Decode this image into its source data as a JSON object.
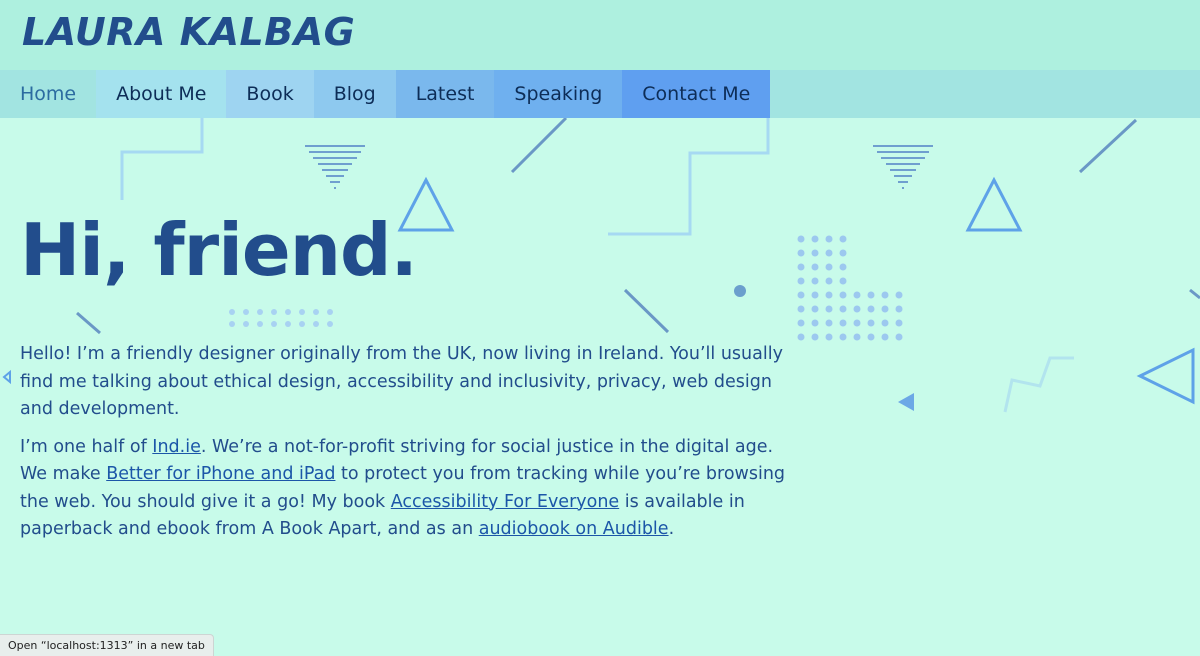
{
  "site": {
    "logo": "LAURA KALBAG"
  },
  "nav": {
    "items": [
      {
        "label": "Home"
      },
      {
        "label": "About Me"
      },
      {
        "label": "Book"
      },
      {
        "label": "Blog"
      },
      {
        "label": "Latest"
      },
      {
        "label": "Speaking"
      },
      {
        "label": "Contact Me"
      }
    ]
  },
  "main": {
    "heading": "Hi, friend.",
    "intro": "Hello! I’m a friendly designer originally from the UK, now living in Ireland. You’ll usually find me talking about ethical design, accessibility and inclusivity, privacy, web design and development.",
    "p2": {
      "t1": "I’m one half of ",
      "link_indie": "Ind.ie",
      "t2": ". We’re a not-for-profit striving for social justice in the digital age. We make ",
      "link_better": "Better for iPhone and iPad",
      "t3": " to protect you from tracking while you’re browsing the web. You should give it a go! My book ",
      "link_book": "Accessibility For Everyone",
      "t4": " is available in paperback and ebook from A Book Apart, and as an ",
      "link_audio": "audiobook on Audible",
      "t5": "."
    }
  },
  "status_bar": {
    "text": "Open “localhost:1313” in a new tab"
  },
  "colors": {
    "background": "#c8fbea",
    "header": "#aef0df",
    "text": "#224d8c",
    "link": "#1b56a8"
  }
}
